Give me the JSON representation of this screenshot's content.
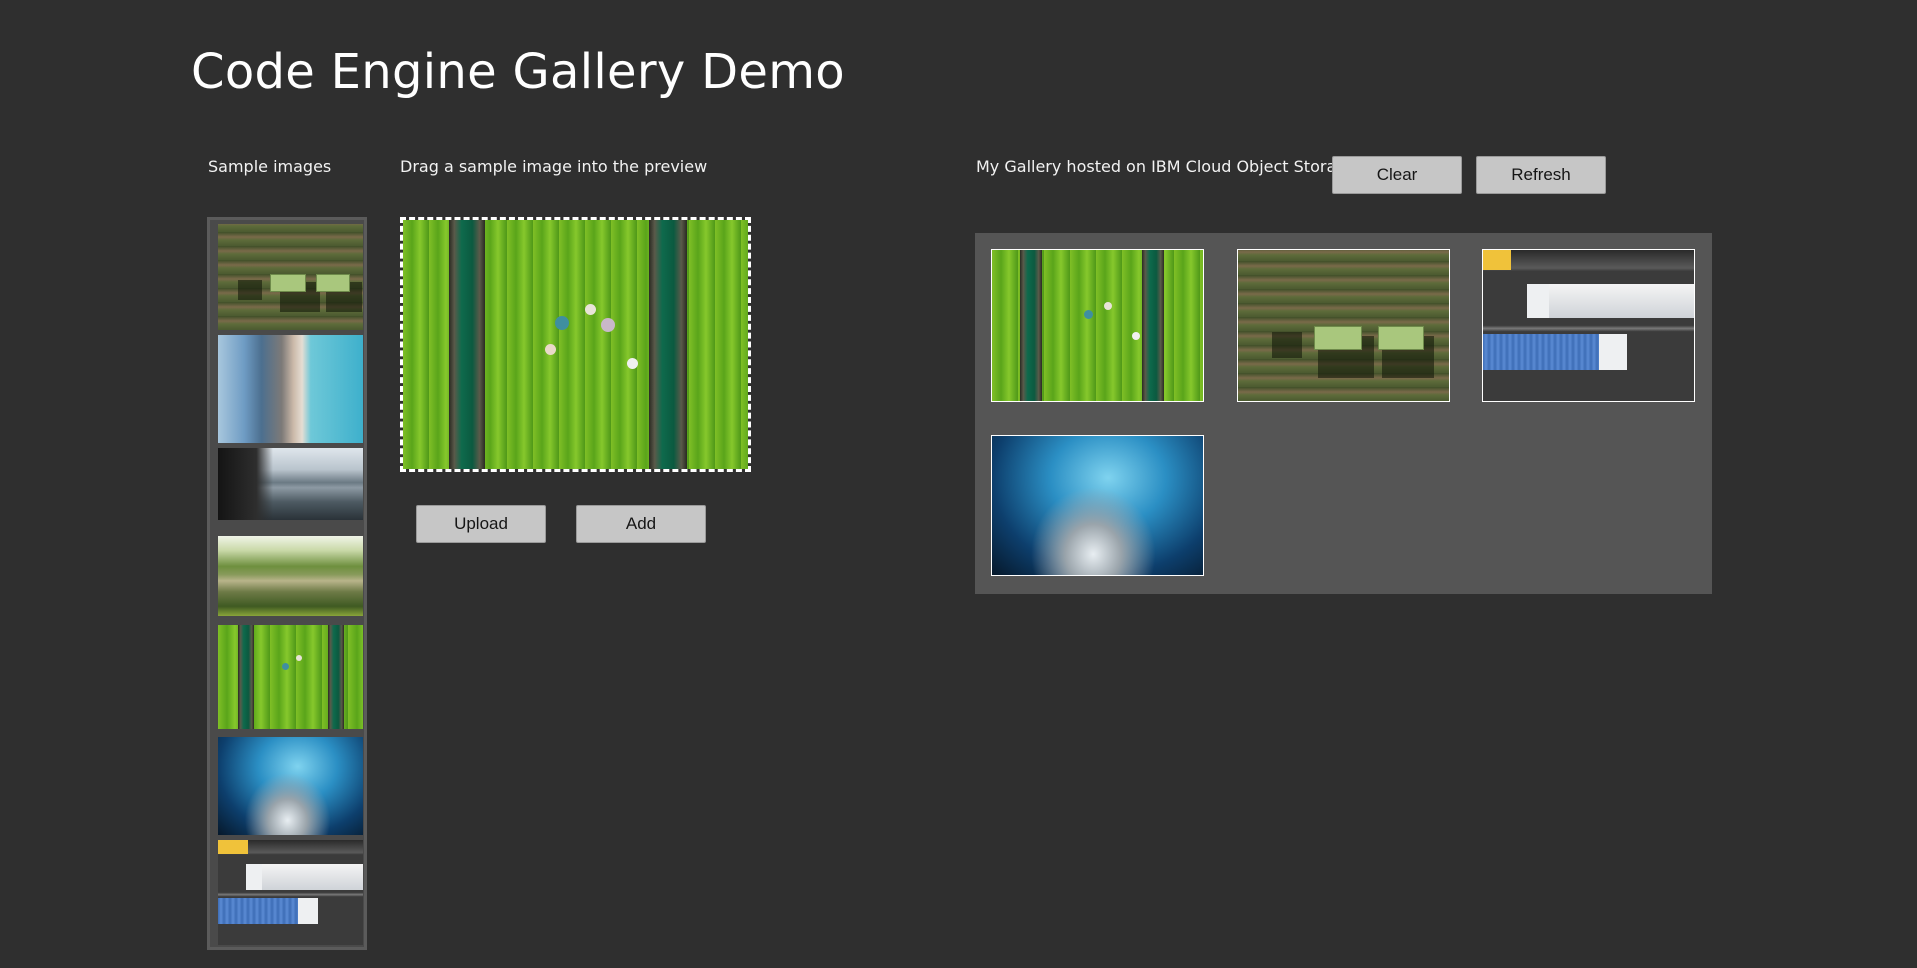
{
  "header": {
    "title": "Code Engine Gallery Demo"
  },
  "samples": {
    "label": "Sample images",
    "items": [
      {
        "name": "aerial-farm"
      },
      {
        "name": "beach-coast"
      },
      {
        "name": "mountain-lake"
      },
      {
        "name": "forest-river"
      },
      {
        "name": "lettuce-field-workers"
      },
      {
        "name": "ice-cave"
      },
      {
        "name": "highway-trucks"
      }
    ]
  },
  "preview": {
    "label": "Drag a sample image into the preview",
    "image": "lettuce-field-workers"
  },
  "actions": {
    "upload_label": "Upload",
    "add_label": "Add"
  },
  "gallery": {
    "label": "My Gallery hosted on IBM Cloud Object Storage",
    "clear_label": "Clear",
    "refresh_label": "Refresh",
    "items": [
      {
        "name": "lettuce-field-workers"
      },
      {
        "name": "aerial-farm"
      },
      {
        "name": "highway-trucks"
      },
      {
        "name": "ice-cave"
      }
    ]
  },
  "colors": {
    "background": "#2f2f2f",
    "gallery_panel": "#555555",
    "button": "#c6c6c6"
  }
}
